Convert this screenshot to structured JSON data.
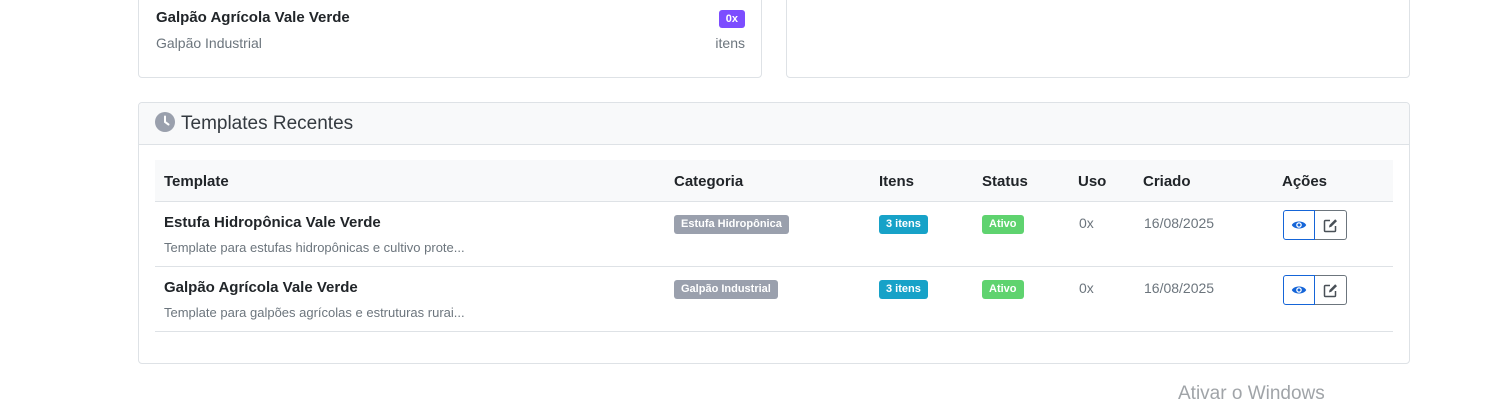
{
  "top_card": {
    "title": "Galpão Agrícola Vale Verde",
    "subtitle": "Galpão Industrial",
    "badge": "0x",
    "itens_label": "itens"
  },
  "recent": {
    "title": "Templates Recentes",
    "icon": "clock-icon",
    "columns": {
      "template": "Template",
      "categoria": "Categoria",
      "itens": "Itens",
      "status": "Status",
      "uso": "Uso",
      "criado": "Criado",
      "acoes": "Ações"
    },
    "rows": [
      {
        "name": "Estufa Hidropônica Vale Verde",
        "description": "Template para estufas hidropônicas e cultivo prote...",
        "category": "Estufa Hidropônica",
        "items": "3 itens",
        "status": "Ativo",
        "usage": "0x",
        "created": "16/08/2025"
      },
      {
        "name": "Galpão Agrícola Vale Verde",
        "description": "Template para galpões agrícolas e estruturas rurai...",
        "category": "Galpão Industrial",
        "items": "3 itens",
        "status": "Ativo",
        "usage": "0x",
        "created": "16/08/2025"
      }
    ]
  },
  "colors": {
    "usage_badge": "#7c4dff",
    "category_badge": "#9aa0ad",
    "items_badge": "#17a2c8",
    "status_badge": "#5fd36f",
    "view_button": "#1565d8"
  },
  "watermark": "Ativar o Windows"
}
